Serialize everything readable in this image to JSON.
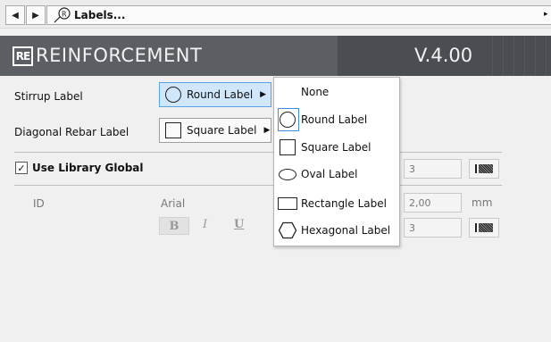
{
  "toolbar": {
    "back_glyph": "◀",
    "forward_glyph": "▶",
    "panel_title": "Labels...",
    "panel_icon": "label-marker-icon",
    "expand_glyph": "▸"
  },
  "header": {
    "logo_text": "RE",
    "title": "REINFORCEMENT",
    "version": "V.4.00"
  },
  "form": {
    "stirrup_label": "Stirrup Label",
    "stirrup_value": "Round Label",
    "diagonal_label": "Diagonal Rebar Label",
    "diagonal_value": "Square Label",
    "use_library_global": "Use Library Global",
    "use_library_checked": "✓",
    "pen_value": "3",
    "id_label": "ID",
    "font_name": "Arial",
    "bold": "B",
    "italic": "I",
    "underline": "U",
    "size_value": "2,00",
    "size_unit": "mm",
    "pen_value_2": "3"
  },
  "menu": {
    "items": [
      {
        "label": "None",
        "icon": "none"
      },
      {
        "label": "Round Label",
        "icon": "circle-icon"
      },
      {
        "label": "Square Label",
        "icon": "square-icon"
      },
      {
        "label": "Oval Label",
        "icon": "oval-icon"
      },
      {
        "label": "Rectangle Label",
        "icon": "rectangle-icon"
      },
      {
        "label": "Hexagonal Label",
        "icon": "hexagon-icon"
      }
    ],
    "selected": "Round Label"
  }
}
